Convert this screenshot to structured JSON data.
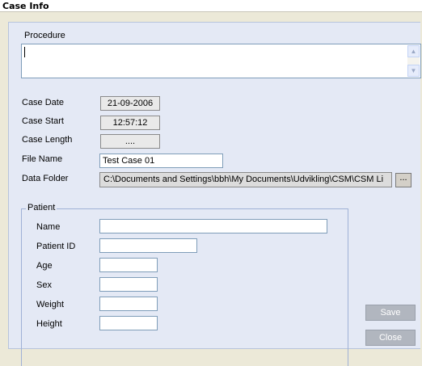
{
  "window": {
    "title": "Case Info"
  },
  "procedure": {
    "label": "Procedure",
    "value": ""
  },
  "case": {
    "date_label": "Case Date",
    "date_value": "21-09-2006",
    "start_label": "Case Start",
    "start_value": "12:57:12",
    "length_label": "Case Length",
    "length_value": "....",
    "file_name_label": "File Name",
    "file_name_value": "Test Case 01",
    "data_folder_label": "Data Folder",
    "data_folder_value": "C:\\Documents and Settings\\bbh\\My Documents\\Udvikling\\CSM\\CSM Li",
    "browse_label": "..."
  },
  "patient": {
    "group_label": "Patient",
    "name_label": "Name",
    "name_value": "",
    "id_label": "Patient ID",
    "id_value": "",
    "age_label": "Age",
    "age_value": "",
    "sex_label": "Sex",
    "sex_value": "",
    "weight_label": "Weight",
    "weight_value": "",
    "height_label": "Height",
    "height_value": ""
  },
  "buttons": {
    "save_label": "Save",
    "close_label": "Close"
  },
  "icons": {
    "scroll_up": "scroll-up-arrow-icon",
    "scroll_down": "scroll-down-arrow-icon"
  }
}
